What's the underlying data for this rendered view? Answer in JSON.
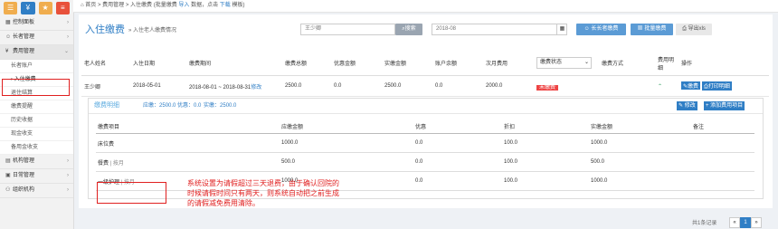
{
  "sidebar": {
    "top_buttons": [
      {
        "glyph": "☰",
        "color": "#f0ad4e",
        "name": "menu"
      },
      {
        "glyph": "¥",
        "color": "#2f7ec5",
        "name": "finance"
      },
      {
        "glyph": "★",
        "color": "#f0ad4e",
        "name": "star"
      },
      {
        "glyph": "≡",
        "color": "#e8513b",
        "name": "list"
      }
    ],
    "items": [
      {
        "label": "控制面板"
      },
      {
        "label": "长者管理"
      },
      {
        "label": "费用管理"
      }
    ],
    "sub_items": [
      {
        "label": "长者账户"
      },
      {
        "label": "入住缴费"
      },
      {
        "label": "退住结算"
      },
      {
        "label": "缴费提醒"
      },
      {
        "label": "历史收据"
      },
      {
        "label": "现金收支"
      },
      {
        "label": "备用金收支"
      }
    ],
    "bottom_items": [
      {
        "label": "机构管理"
      },
      {
        "label": "日常管理"
      },
      {
        "label": "组织机构"
      }
    ]
  },
  "topbar": {
    "home": "首页",
    "sep1": ">",
    "crumb1": "费用管理",
    "sep2": ">",
    "crumb2": "入住缴费",
    "note": "(批量缴费",
    "import": "导入",
    "note2": "数据，点击",
    "download": "下载",
    "note3": "模板)"
  },
  "header": {
    "title": "入住缴费",
    "subtitle": "» 入住老人缴费情况",
    "search_value": "王少卿",
    "search_btn": "搜索",
    "date_value": "2018-08",
    "btn_remind": "长长者缴费",
    "btn_batch": "批量缴费",
    "btn_export": "导出xls"
  },
  "table": {
    "headers": [
      "老人姓名",
      "入住日期",
      "缴费期间",
      "缴费总额",
      "优惠金额",
      "实缴金额",
      "账户余额",
      "次月费用",
      "缴费状态",
      "缴费方式",
      "费用明细",
      "操作"
    ],
    "status_select": "缴费状态",
    "row": {
      "name": "王少卿",
      "date": "2018-05-01",
      "period": "2018-08-01 ~ 2018-08-31",
      "period_link": "修改",
      "total": "2500.0",
      "discount": "0.0",
      "paid": "2500.0",
      "balance": "0.0",
      "next": "2000.0",
      "status": "未缴费",
      "method": "",
      "op_pay": "缴费",
      "op_print": "打印明细"
    }
  },
  "detail": {
    "title": "缴费明细",
    "sum_due_label": "应缴：",
    "sum_due": "2500.0",
    "sum_discount_label": "优惠：",
    "sum_discount": "0.0",
    "sum_paid_label": "实缴：",
    "sum_paid": "2500.0",
    "btn_edit": "修改",
    "btn_add": "+ 添加费用项目",
    "headers": [
      "缴费项目",
      "应缴金额",
      "优惠",
      "折扣",
      "实缴金额",
      "备注"
    ],
    "rows": [
      {
        "item": "床位费",
        "tag": "",
        "due": "1000.0",
        "discount": "0.0",
        "rate": "100.0",
        "paid": "1000.0",
        "note": ""
      },
      {
        "item": "餐费",
        "tag": "按月",
        "due": "500.0",
        "discount": "0.0",
        "rate": "100.0",
        "paid": "500.0",
        "note": ""
      },
      {
        "item": "一级护理",
        "tag": "按月",
        "due": "1000.0",
        "discount": "0.0",
        "rate": "100.0",
        "paid": "1000.0",
        "note": ""
      }
    ]
  },
  "annotation": {
    "text": "系统设置为请假超过三天退费，由于确认回院的时候请假时间只有两天，则系统自动把之前生成的请假减免费用清除。"
  },
  "pager": {
    "summary": "共1条记录",
    "prev": "«",
    "page": "1",
    "next": "»"
  },
  "colors": {
    "accent": "#2f7ec5",
    "danger": "#e44444",
    "annotation": "#e02020"
  }
}
